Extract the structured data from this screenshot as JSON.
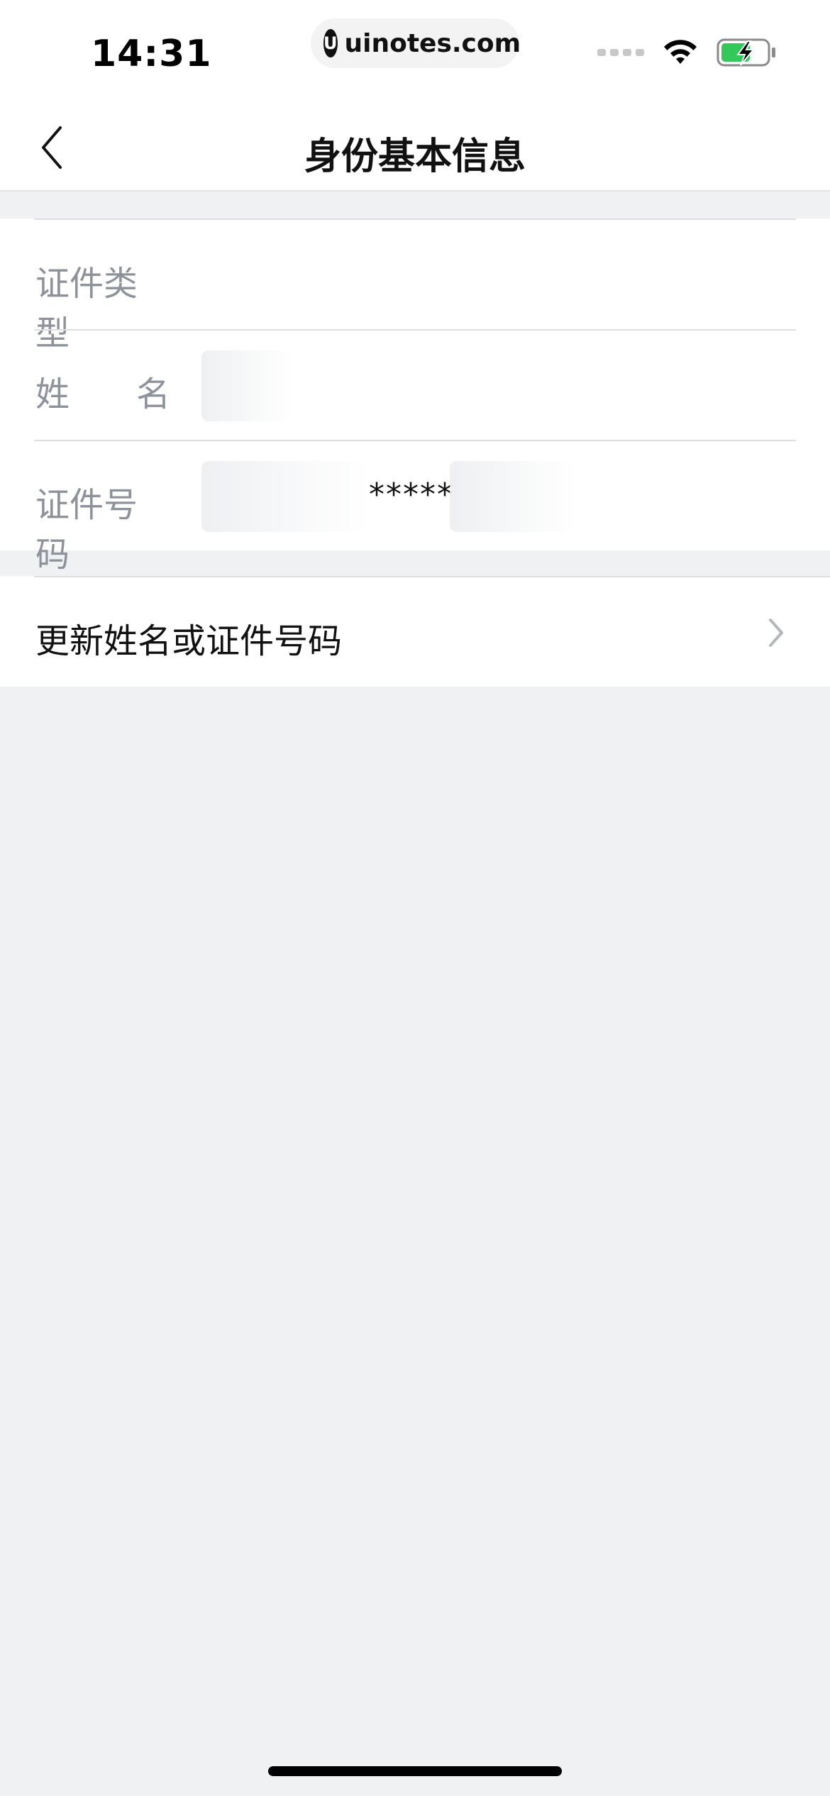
{
  "status_bar": {
    "time": "14:31",
    "url": "uinotes.com",
    "url_logo_letter": "U",
    "wifi_icon": "wifi-icon",
    "battery_icon": "battery-charging-icon",
    "battery_color": "#34c759"
  },
  "nav": {
    "title": "身份基本信息",
    "back_icon": "chevron-left-icon"
  },
  "info": {
    "rows": [
      {
        "label": "证件类型",
        "value": ""
      },
      {
        "label_chars": [
          "姓",
          "名"
        ],
        "value": ""
      },
      {
        "label": "证件号码",
        "value_mask": "*****"
      }
    ]
  },
  "action": {
    "label": "更新姓名或证件号码",
    "chevron_icon": "chevron-right-icon"
  },
  "colors": {
    "background": "#f0f1f3",
    "card": "#ffffff",
    "label_gray": "#8e939b",
    "text_dark": "#111111",
    "divider": "#dedfe2"
  }
}
